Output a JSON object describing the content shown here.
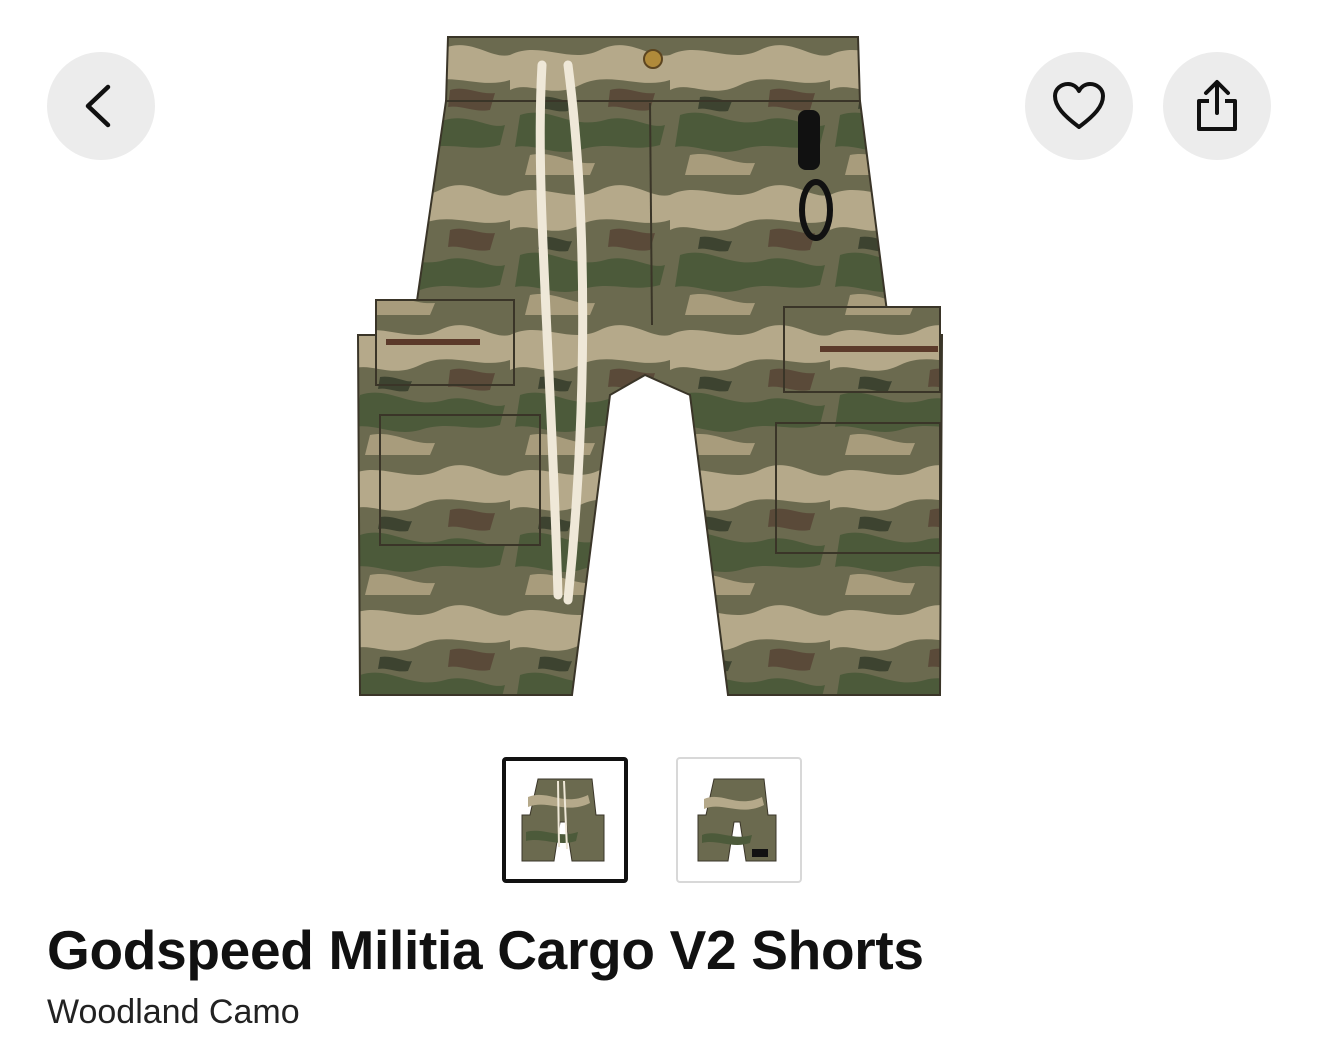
{
  "navigation": {
    "back_icon": "chevron-left-icon",
    "favorite_icon": "heart-icon",
    "share_icon": "share-icon"
  },
  "gallery": {
    "image_count": 2,
    "selected_index": 0
  },
  "product": {
    "name": "Godspeed Militia Cargo V2 Shorts",
    "colorway": "Woodland Camo"
  },
  "colors": {
    "button_bg": "#ececec",
    "camo_base": "#6b6a4f",
    "camo_tan": "#b5a98a",
    "camo_green": "#4c5a3a",
    "camo_brown": "#5a4a39"
  }
}
